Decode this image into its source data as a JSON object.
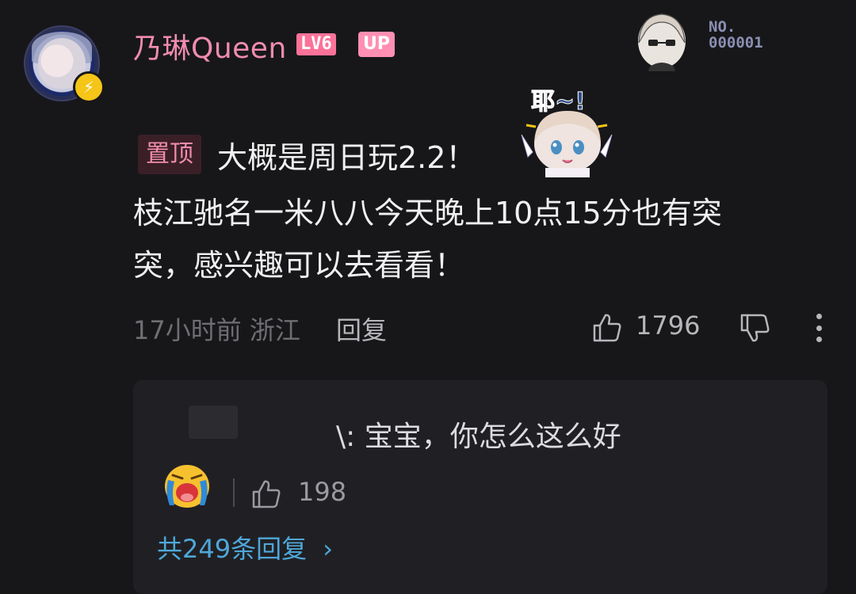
{
  "comment": {
    "username": "乃琳Queen",
    "level_badge": "LV6",
    "up_badge": "UP",
    "fan_number_label": "NO.",
    "fan_number": "000001",
    "pinned_tag": "置顶",
    "sticker_text": "耶~!",
    "text_line1": "大概是周日玩2.2！",
    "text_line2": "枝江驰名一米八八今天晚上10点15分也有突",
    "text_line3": "突，感兴趣可以去看看！",
    "time": "17小时前",
    "location": "浙江",
    "reply_label": "回复",
    "like_count": "1796"
  },
  "reply_preview": {
    "text": "\\: 宝宝，你怎么这么好",
    "like_count": "198",
    "view_all_label": "共249条回复",
    "view_all_chevron": "›"
  },
  "colors": {
    "background": "#17171a",
    "username_pink": "#f08cad",
    "badge_pink": "#fb7299",
    "link_blue": "#4ea7d8"
  },
  "icons": [
    "bolt-icon",
    "thumb-up-icon",
    "thumb-down-icon",
    "more-vertical-icon",
    "crying-emoji-icon"
  ]
}
